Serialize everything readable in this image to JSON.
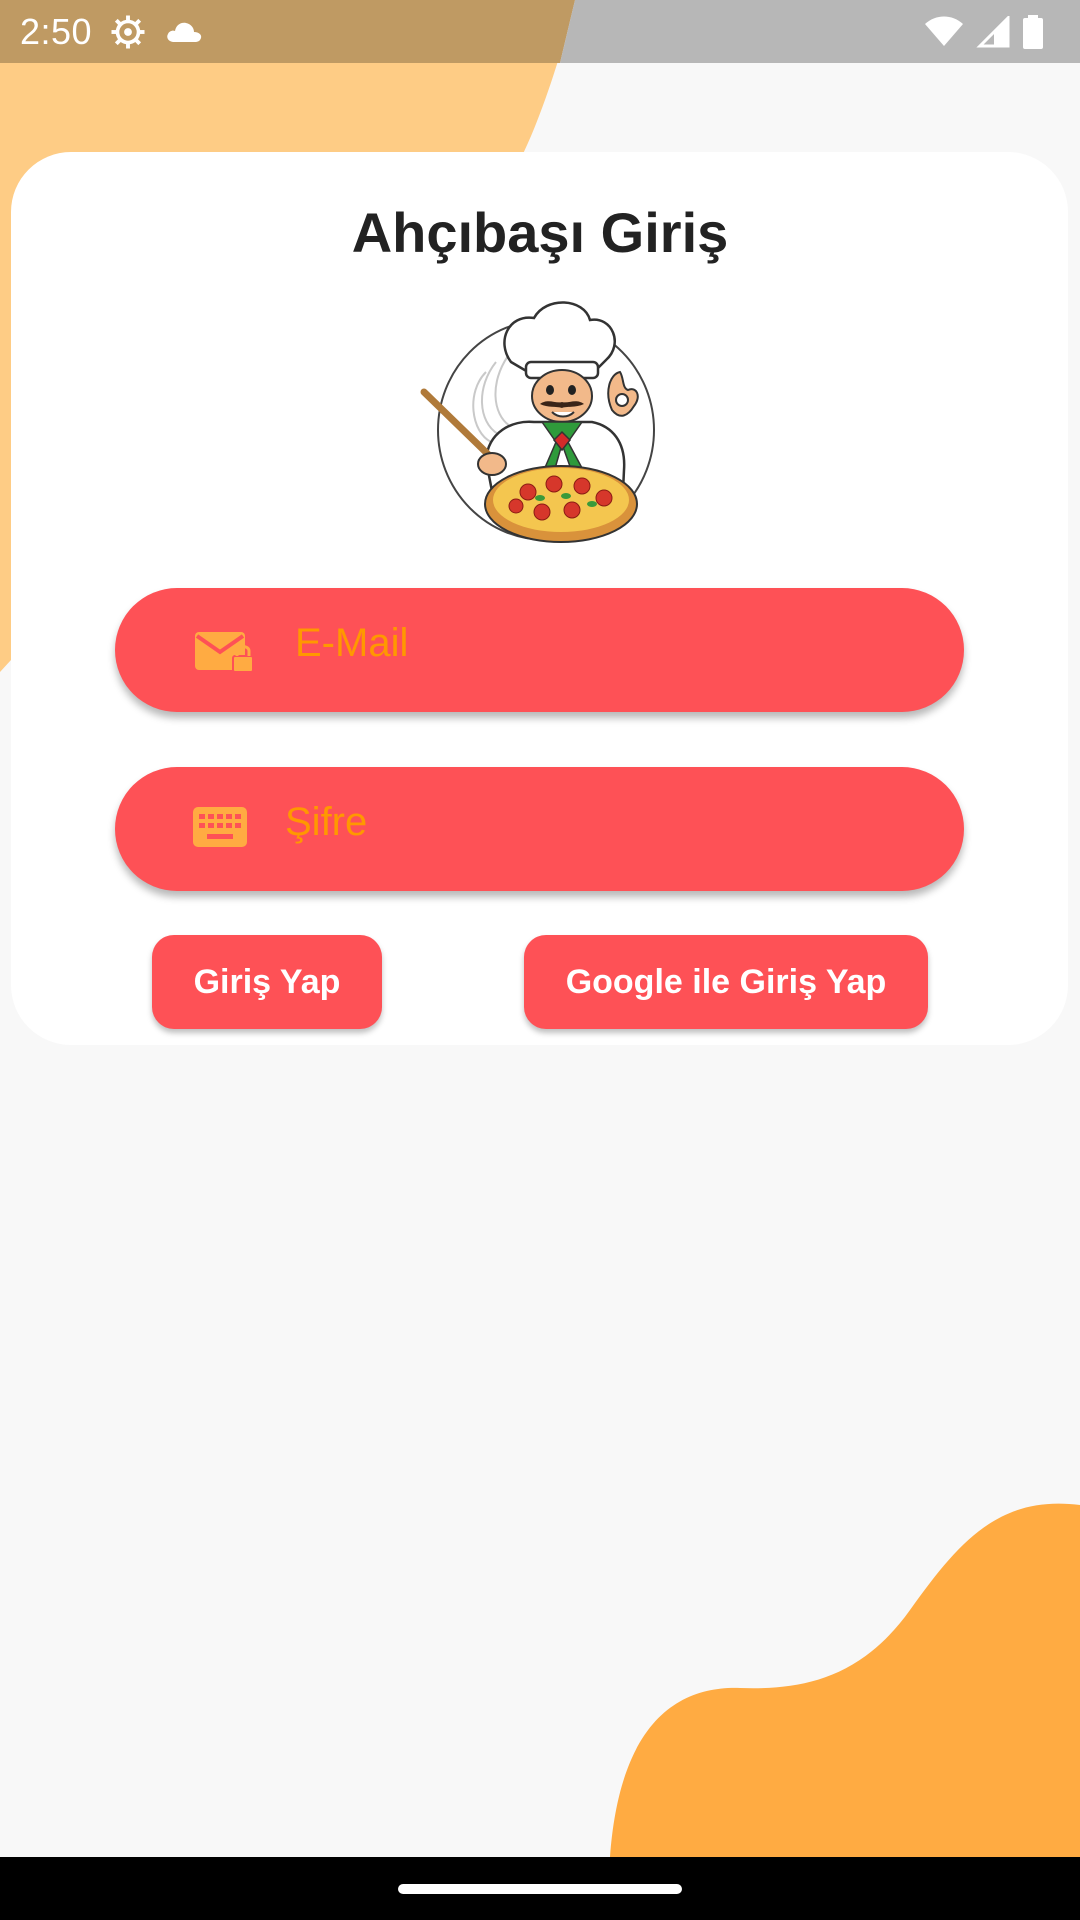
{
  "status_bar": {
    "time": "2:50",
    "left_icons": [
      "settings-icon",
      "cloud-icon"
    ],
    "right_icons": [
      "wifi-icon",
      "signal-icon",
      "battery-icon"
    ]
  },
  "login": {
    "title": "Ahçıbaşı Giriş",
    "image": "chef-pizza-illustration",
    "email": {
      "placeholder": "E-Mail",
      "value": "",
      "icon": "mail-lock-icon"
    },
    "password": {
      "placeholder": "Şifre",
      "value": "",
      "icon": "keyboard-icon"
    },
    "login_button": "Giriş Yap",
    "google_button": "Google ile Giriş Yap"
  },
  "colors": {
    "accent": "#fe5156",
    "placeholder": "#ff9800",
    "blob_top": "#fecc85",
    "blob_bottom": "#ffab42",
    "background": "#f8f8f8"
  }
}
